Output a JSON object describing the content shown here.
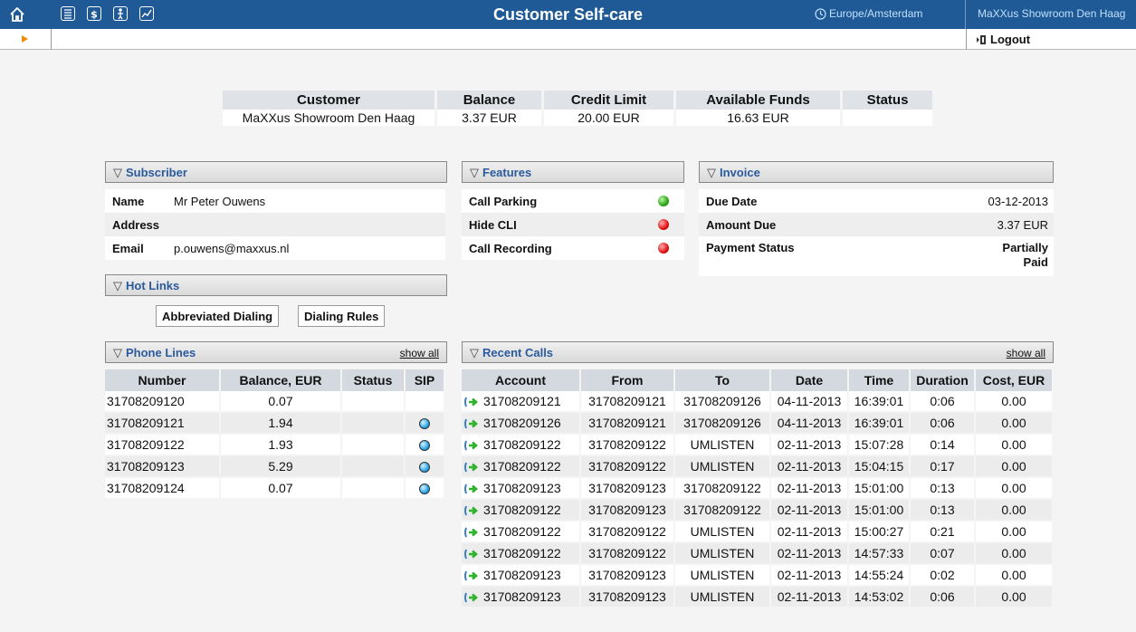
{
  "header": {
    "title": "Customer Self-care",
    "timezone": "Europe/Amsterdam",
    "account": "MaXXus Showroom Den Haag",
    "logout_label": "Logout",
    "colors": {
      "bar": "#1f5a96",
      "accent": "#f08a00"
    },
    "icons": [
      "home-icon",
      "list-icon",
      "dollar-icon",
      "person-icon",
      "chart-icon"
    ]
  },
  "summary": {
    "headers": [
      "Customer",
      "Balance",
      "Credit Limit",
      "Available Funds",
      "Status"
    ],
    "values": [
      "MaXXus Showroom Den Haag",
      "3.37 EUR",
      "20.00 EUR",
      "16.63 EUR",
      ""
    ]
  },
  "subscriber": {
    "title": "Subscriber",
    "rows": [
      {
        "label": "Name",
        "value": "Mr Peter Ouwens"
      },
      {
        "label": "Address",
        "value": ""
      },
      {
        "label": "Email",
        "value": "p.ouwens@maxxus.nl"
      }
    ]
  },
  "features": {
    "title": "Features",
    "rows": [
      {
        "label": "Call Parking",
        "state": "green"
      },
      {
        "label": "Hide CLI",
        "state": "red"
      },
      {
        "label": "Call Recording",
        "state": "red"
      }
    ]
  },
  "invoice": {
    "title": "Invoice",
    "rows": [
      {
        "label": "Due Date",
        "value": "03-12-2013"
      },
      {
        "label": "Amount Due",
        "value": "3.37 EUR"
      },
      {
        "label": "Payment Status",
        "value_line1": "Partially",
        "value_line2": "Paid"
      }
    ]
  },
  "hotlinks": {
    "title": "Hot Links",
    "buttons": [
      "Abbreviated Dialing",
      "Dialing Rules"
    ]
  },
  "phone_lines": {
    "title": "Phone Lines",
    "show_all": "show all",
    "columns": [
      "Number",
      "Balance, EUR",
      "Status",
      "SIP"
    ],
    "rows": [
      {
        "number": "31708209120",
        "balance": "0.07",
        "status": "",
        "sip": false
      },
      {
        "number": "31708209121",
        "balance": "1.94",
        "status": "",
        "sip": true
      },
      {
        "number": "31708209122",
        "balance": "1.93",
        "status": "",
        "sip": true
      },
      {
        "number": "31708209123",
        "balance": "5.29",
        "status": "",
        "sip": true
      },
      {
        "number": "31708209124",
        "balance": "0.07",
        "status": "",
        "sip": true
      }
    ]
  },
  "recent_calls": {
    "title": "Recent Calls",
    "show_all": "show all",
    "columns": [
      "Account",
      "From",
      "To",
      "Date",
      "Time",
      "Duration",
      "Cost, EUR"
    ],
    "rows": [
      {
        "account": "31708209121",
        "from": "31708209121",
        "to": "31708209126",
        "date": "04-11-2013",
        "time": "16:39:01",
        "duration": "0:06",
        "cost": "0.00"
      },
      {
        "account": "31708209126",
        "from": "31708209121",
        "to": "31708209126",
        "date": "04-11-2013",
        "time": "16:39:01",
        "duration": "0:06",
        "cost": "0.00"
      },
      {
        "account": "31708209122",
        "from": "31708209122",
        "to": "UMLISTEN",
        "date": "02-11-2013",
        "time": "15:07:28",
        "duration": "0:14",
        "cost": "0.00"
      },
      {
        "account": "31708209122",
        "from": "31708209122",
        "to": "UMLISTEN",
        "date": "02-11-2013",
        "time": "15:04:15",
        "duration": "0:17",
        "cost": "0.00"
      },
      {
        "account": "31708209123",
        "from": "31708209123",
        "to": "31708209122",
        "date": "02-11-2013",
        "time": "15:01:00",
        "duration": "0:13",
        "cost": "0.00"
      },
      {
        "account": "31708209122",
        "from": "31708209123",
        "to": "31708209122",
        "date": "02-11-2013",
        "time": "15:01:00",
        "duration": "0:13",
        "cost": "0.00"
      },
      {
        "account": "31708209122",
        "from": "31708209122",
        "to": "UMLISTEN",
        "date": "02-11-2013",
        "time": "15:00:27",
        "duration": "0:21",
        "cost": "0.00"
      },
      {
        "account": "31708209122",
        "from": "31708209122",
        "to": "UMLISTEN",
        "date": "02-11-2013",
        "time": "14:57:33",
        "duration": "0:07",
        "cost": "0.00"
      },
      {
        "account": "31708209123",
        "from": "31708209123",
        "to": "UMLISTEN",
        "date": "02-11-2013",
        "time": "14:55:24",
        "duration": "0:02",
        "cost": "0.00"
      },
      {
        "account": "31708209123",
        "from": "31708209123",
        "to": "UMLISTEN",
        "date": "02-11-2013",
        "time": "14:53:02",
        "duration": "0:06",
        "cost": "0.00"
      }
    ]
  }
}
